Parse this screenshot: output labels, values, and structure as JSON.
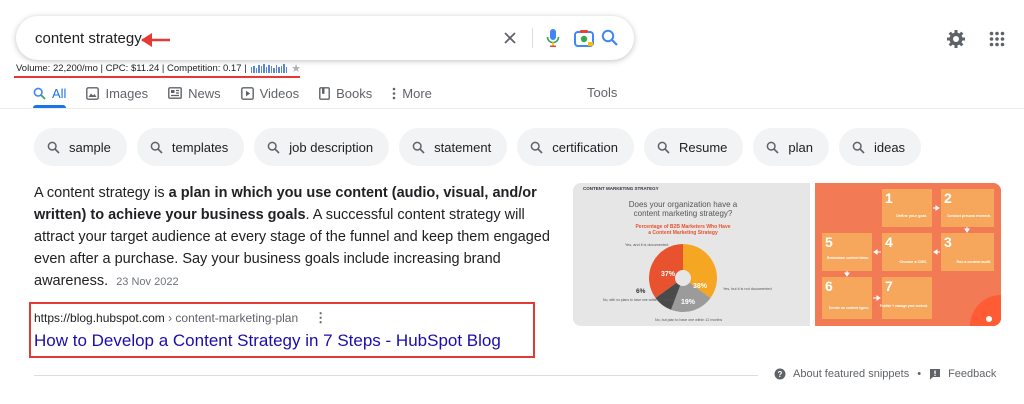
{
  "search": {
    "query": "content strategy"
  },
  "keyword_stats": {
    "text": "Volume: 22,200/mo | CPC: $11.24 | Competition: 0.17 |"
  },
  "tabs": [
    {
      "label": "All",
      "icon": "search-icon"
    },
    {
      "label": "Images",
      "icon": "image-icon"
    },
    {
      "label": "News",
      "icon": "news-icon"
    },
    {
      "label": "Videos",
      "icon": "play-icon"
    },
    {
      "label": "Books",
      "icon": "book-icon"
    },
    {
      "label": "More",
      "icon": "more-vert-icon"
    }
  ],
  "tools_label": "Tools",
  "chips": [
    {
      "label": "sample"
    },
    {
      "label": "templates"
    },
    {
      "label": "job description"
    },
    {
      "label": "statement"
    },
    {
      "label": "certification"
    },
    {
      "label": "Resume"
    },
    {
      "label": "plan"
    },
    {
      "label": "ideas"
    }
  ],
  "snippet": {
    "intro": "A content strategy is ",
    "bold": "a plan in which you use content (audio, visual, and/or written) to achieve your business goals",
    "rest": ". A successful content strategy will attract your target audience at every stage of the funnel and keep them engaged even after a purchase. Say your business goals include increasing brand awareness.",
    "date": "23 Nov 2022"
  },
  "result": {
    "domain": "https://blog.hubspot.com",
    "path": "› content-marketing-plan",
    "title": "How to Develop a Content Strategy in 7 Steps - HubSpot Blog"
  },
  "image1": {
    "header": "CONTENT MARKETING STRATEGY",
    "question": "Does your organization have a content marketing strategy?",
    "subtitle": "Percentage of B2B Marketers Who Have a Content Marketing Strategy",
    "slices": [
      {
        "label": "Yes, and it is documented",
        "value": "37%",
        "color": "#e8522f"
      },
      {
        "label": "Yes, but it is not documented",
        "value": "38%",
        "color": "#f5a623"
      },
      {
        "label": "No, but plan to have one within 12 months",
        "value": "19%",
        "color": "#9b9b9b"
      },
      {
        "label": "No, with no plans to have one within 12 months",
        "value": "6%",
        "color": "#4a4a4a"
      }
    ]
  },
  "image2": {
    "steps": [
      {
        "n": "1",
        "label": "Define your goal."
      },
      {
        "n": "2",
        "label": "Conduct persona research."
      },
      {
        "n": "3",
        "label": "Run a content audit."
      },
      {
        "n": "4",
        "label": "Choose a CMS."
      },
      {
        "n": "5",
        "label": "Brainstorm content ideas."
      },
      {
        "n": "6",
        "label": "Decide on content types."
      },
      {
        "n": "7",
        "label": "Publish + manage your content."
      }
    ]
  },
  "footer": {
    "about": "About featured snippets",
    "feedback": "Feedback"
  },
  "colors": {
    "accent": "#1a73e8",
    "link": "#1a0dab",
    "annotation_red": "#e53935"
  }
}
